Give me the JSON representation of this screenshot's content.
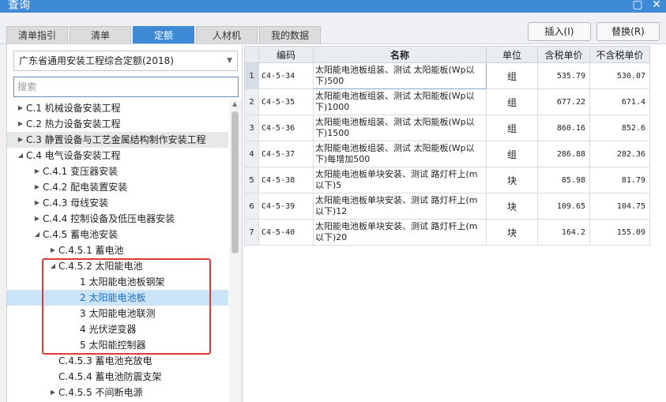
{
  "window": {
    "title": "查询",
    "restore_label": "▢",
    "close_label": "✕"
  },
  "tabs": [
    {
      "label": "清单指引",
      "active": false
    },
    {
      "label": "清单",
      "active": false
    },
    {
      "label": "定额",
      "active": true
    },
    {
      "label": "人材机",
      "active": false
    },
    {
      "label": "我的数据",
      "active": false
    }
  ],
  "toolbar": {
    "insert_label": "插入(I)",
    "replace_label": "替换(R)"
  },
  "quota_library": {
    "selected": "广东省通用安装工程综合定额(2018)"
  },
  "search": {
    "placeholder": "搜索"
  },
  "tree": [
    {
      "label": "C.1 机械设备安装工程",
      "level": 0,
      "toggle": "▶"
    },
    {
      "label": "C.2 热力设备安装工程",
      "level": 0,
      "toggle": "▶"
    },
    {
      "label": "C.3 静置设备与工艺金属结构制作安装工程",
      "level": 0,
      "toggle": "▶",
      "hover": true
    },
    {
      "label": "C.4 电气设备安装工程",
      "level": 0,
      "toggle": "◢"
    },
    {
      "label": "C.4.1 变压器安装",
      "level": 1,
      "toggle": "▶"
    },
    {
      "label": "C.4.2 配电装置安装",
      "level": 1,
      "toggle": "▶"
    },
    {
      "label": "C.4.3 母线安装",
      "level": 1,
      "toggle": "▶"
    },
    {
      "label": "C.4.4 控制设备及低压电器安装",
      "level": 1,
      "toggle": "▶"
    },
    {
      "label": "C.4.5 蓄电池安装",
      "level": 1,
      "toggle": "◢"
    },
    {
      "label": "C.4.5.1 蓄电池",
      "level": 2,
      "toggle": "▶"
    },
    {
      "label": "C.4.5.2 太阳能电池",
      "level": 2,
      "toggle": "◢"
    },
    {
      "label": "1 太阳能电池板钢架",
      "level": 3,
      "toggle": ""
    },
    {
      "label": "2 太阳能电池板",
      "level": 3,
      "toggle": "",
      "selected": true
    },
    {
      "label": "3 太阳能电池联测",
      "level": 3,
      "toggle": ""
    },
    {
      "label": "4 光伏逆变器",
      "level": 3,
      "toggle": ""
    },
    {
      "label": "5 太阳能控制器",
      "level": 3,
      "toggle": ""
    },
    {
      "label": "C.4.5.3 蓄电池充放电",
      "level": 2,
      "toggle": ""
    },
    {
      "label": "C.4.5.4 蓄电池防震支架",
      "level": 2,
      "toggle": ""
    },
    {
      "label": "C.4.5.5 不间断电源",
      "level": 2,
      "toggle": "▶"
    }
  ],
  "grid": {
    "columns": [
      "",
      "编码",
      "名称",
      "单位",
      "含税单价",
      "不含税单价"
    ],
    "rows": [
      {
        "idx": "1",
        "code": "C4-5-34",
        "name": "太阳能电池板组装、测试 太阳能板(Wp以下)500",
        "unit": "组",
        "price_tax": "535.79",
        "price_notax": "530.07"
      },
      {
        "idx": "2",
        "code": "C4-5-35",
        "name": "太阳能电池板组装、测试 太阳能板(Wp以下)1000",
        "unit": "组",
        "price_tax": "677.22",
        "price_notax": "671.4"
      },
      {
        "idx": "3",
        "code": "C4-5-36",
        "name": "太阳能电池板组装、测试 太阳能板(Wp以下)1500",
        "unit": "组",
        "price_tax": "860.16",
        "price_notax": "852.6"
      },
      {
        "idx": "4",
        "code": "C4-5-37",
        "name": "太阳能电池板组装、测试 太阳能板(Wp以下)每增加500",
        "unit": "组",
        "price_tax": "286.88",
        "price_notax": "282.36"
      },
      {
        "idx": "5",
        "code": "C4-5-38",
        "name": "太阳能电池板单块安装、测试 路灯杆上(m以下)5",
        "unit": "块",
        "price_tax": "85.98",
        "price_notax": "81.79"
      },
      {
        "idx": "6",
        "code": "C4-5-39",
        "name": "太阳能电池板单块安装、测试 路灯杆上(m以下)12",
        "unit": "块",
        "price_tax": "109.65",
        "price_notax": "104.75"
      },
      {
        "idx": "7",
        "code": "C4-5-40",
        "name": "太阳能电池板单块安装、测试 路灯杆上(m以下)20",
        "unit": "块",
        "price_tax": "164.2",
        "price_notax": "155.09"
      }
    ]
  },
  "colors": {
    "accent": "#3f8ad6",
    "highlight_box": "#e03b3b",
    "selected_row": "#cce4f7"
  }
}
